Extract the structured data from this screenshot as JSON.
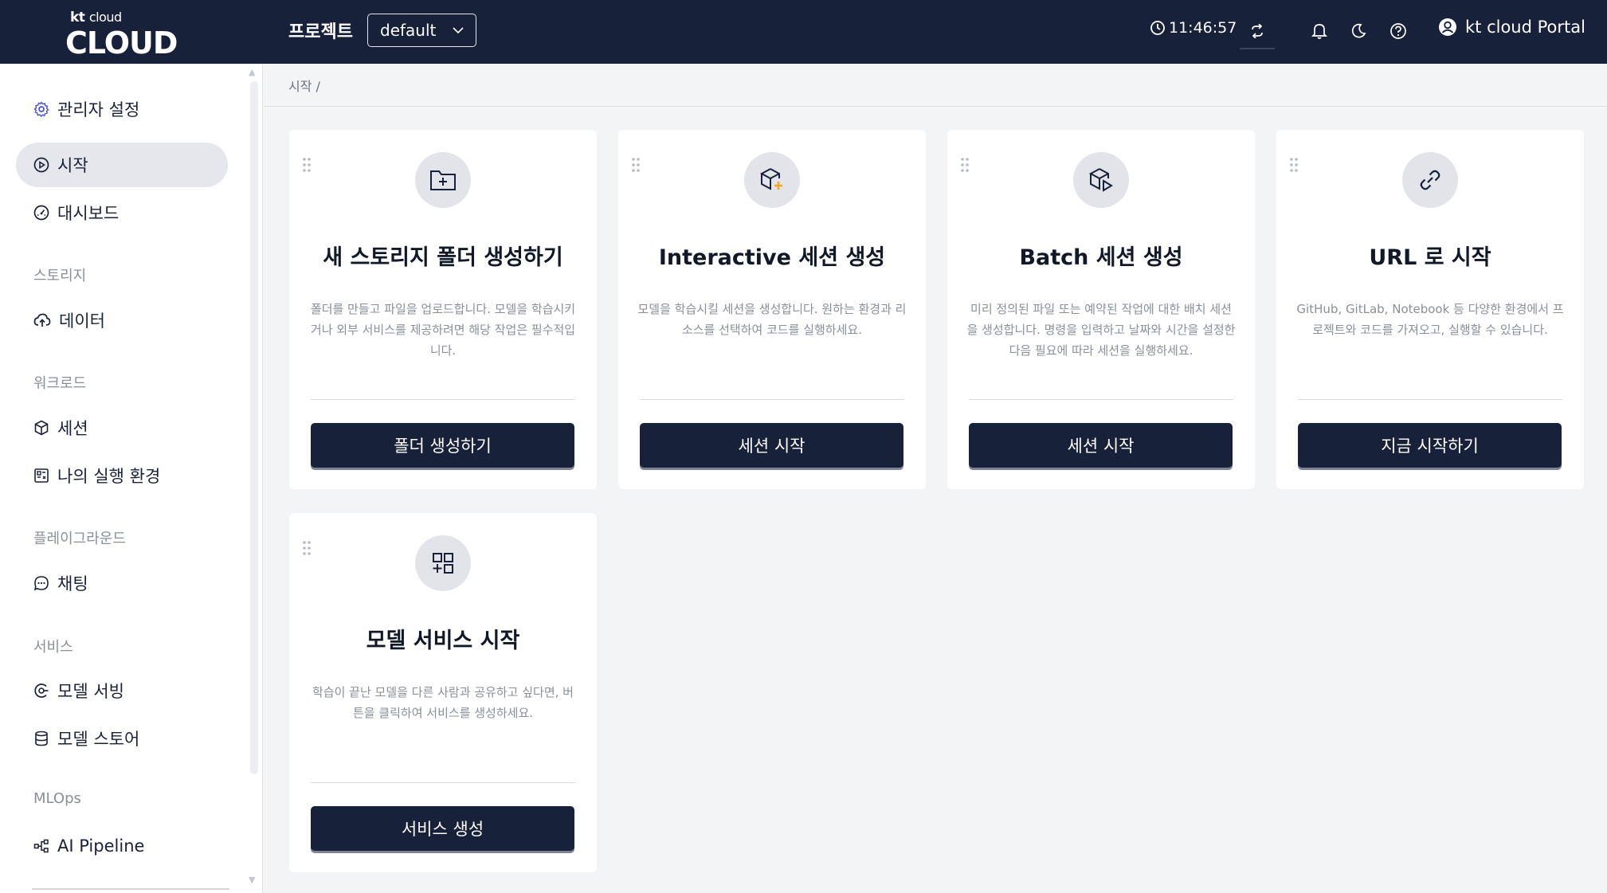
{
  "header": {
    "logo_small": "kt",
    "logo_small2": "cloud",
    "logo_big": "CLOUD",
    "project_label": "프로젝트",
    "project_value": "default",
    "time": "11:46:57",
    "user_name": "kt cloud Portal"
  },
  "sidebar": {
    "items": [
      {
        "label": "관리자 설정"
      },
      {
        "label": "시작"
      },
      {
        "label": "대시보드"
      },
      {
        "label": "데이터"
      },
      {
        "label": "세션"
      },
      {
        "label": "나의 실행 환경"
      },
      {
        "label": "채팅"
      },
      {
        "label": "모델 서빙"
      },
      {
        "label": "모델 스토어"
      },
      {
        "label": "AI Pipeline"
      }
    ],
    "sections": [
      "스토리지",
      "워크로드",
      "플레이그라운드",
      "서비스",
      "MLOps"
    ]
  },
  "breadcrumb": "시작  /",
  "cards": [
    {
      "title": "새 스토리지 폴더 생성하기",
      "desc": "폴더를 만들고 파일을 업로드합니다. 모델을 학습시키거나 외부 서비스를 제공하려면 해당 작업은 필수적입니다.",
      "button": "폴더 생성하기"
    },
    {
      "title": "Interactive 세션 생성",
      "desc": "모델을 학습시킬 세션을 생성합니다. 원하는 환경과 리소스를 선택하여 코드를 실행하세요.",
      "button": "세션 시작"
    },
    {
      "title": "Batch 세션 생성",
      "desc": "미리 정의된 파일 또는 예약된 작업에 대한 배치 세션을 생성합니다. 명령을 입력하고 날짜와 시간을 설정한 다음 필요에 따라 세션을 실행하세요.",
      "button": "세션 시작"
    },
    {
      "title": "URL 로 시작",
      "desc": "GitHub, GitLab, Notebook 등 다양한 환경에서 프로젝트와 코드를 가져오고, 실행할 수 있습니다.",
      "button": "지금 시작하기"
    },
    {
      "title": "모델 서비스 시작",
      "desc": "학습이 끝난 모델을 다른 사람과 공유하고 싶다면, 버튼을 클릭하여 서비스를 생성하세요.",
      "button": "서비스 생성"
    }
  ],
  "colors": {
    "header_bg": "#18213a",
    "button_bg": "#18213a",
    "accent_orange": "#f5a623",
    "admin_icon": "#4a4fd6"
  }
}
